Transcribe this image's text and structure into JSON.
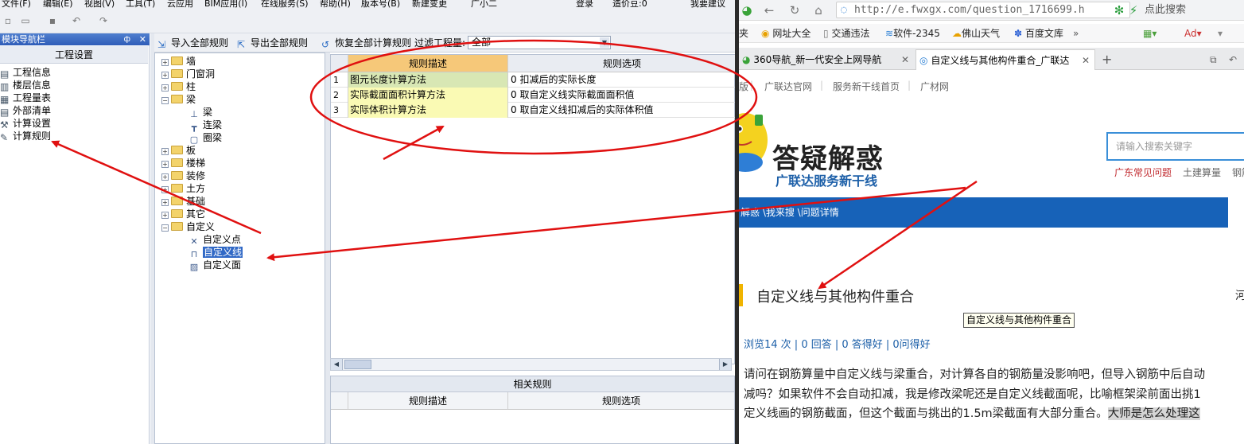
{
  "menubar": [
    "文件(F)",
    "编辑(E)",
    "视图(V)",
    "工具(T)",
    "云应用",
    "BIM应用(I)",
    "在线服务(S)",
    "帮助(H)",
    "版本号(B)",
    "新建变更",
    "广小二",
    "登录",
    "造价豆:0",
    "我要建议"
  ],
  "nav": {
    "title": "模块导航栏",
    "pin": "ф",
    "close": "✕",
    "group": "工程设置",
    "items": [
      "工程信息",
      "楼层信息",
      "工程量表",
      "外部清单",
      "计算设置",
      "计算规则"
    ]
  },
  "rulebar": {
    "import_all": "导入全部规则",
    "export_all": "导出全部规则",
    "restore_all": "恢复全部计算规则",
    "filter_label": "过滤工程量:",
    "filter_value": "全部"
  },
  "tree": {
    "folders": [
      "墙",
      "门窗洞",
      "柱",
      "梁",
      "板",
      "楼梯",
      "装修",
      "土方",
      "基础",
      "其它",
      "自定义"
    ],
    "beam_children": [
      "梁",
      "连梁",
      "圈梁"
    ],
    "custom_children": [
      "自定义点",
      "自定义线",
      "自定义面"
    ]
  },
  "grid": {
    "headers": [
      "规则描述",
      "规则选项"
    ],
    "rows": [
      {
        "n": "1",
        "desc": "图元长度计算方法",
        "opt": "0  扣减后的实际长度"
      },
      {
        "n": "2",
        "desc": "实际截面面积计算方法",
        "opt": "0   取自定义线实际截面面积值"
      },
      {
        "n": "3",
        "desc": "实际体积计算方法",
        "opt": "0   取自定义线扣减后的实际体积值"
      }
    ]
  },
  "related": {
    "title": "相关规则",
    "headers": [
      "规则描述",
      "规则选项"
    ]
  },
  "browser": {
    "url": "http://e.fwxgx.com/question_1716699.h",
    "search_placeholder": "点此搜索",
    "bookmarks": [
      "网址大全",
      "交通违法",
      "软件-2345",
      "佛山天气",
      "百度文库",
      "»"
    ],
    "bookmark_prefix": "夹",
    "tabs": [
      {
        "title": "360导航_新一代安全上网导航",
        "active": false
      },
      {
        "title": "自定义线与其他构件重合_广联达",
        "active": true
      }
    ],
    "new_tab": "+",
    "site_nav": [
      "版",
      "广联达官网",
      "服务新干线首页",
      "广材网"
    ],
    "logo_title": "答疑解惑",
    "logo_sub": "广联达服务新干线",
    "site_search_placeholder": "请输入搜索关键字",
    "categories": [
      "广东常见问题",
      "土建算量",
      "钢筋"
    ],
    "breadcrumb": "解惑 \\我来搜 \\问题详情",
    "question_title": "自定义线与其他构件重合",
    "question_more": "河",
    "tooltip": "自定义线与其他构件重合",
    "stats": "浏览14 次 | 0 回答 | 0 答得好 | 0问得好",
    "body_lines": [
      "请问在钢筋算量中自定义线与梁重合，对计算各自的钢筋量没影响吧，但导入钢筋中后自动",
      "减吗？如果软件不会自动扣减，我是修改梁呢还是自定义线截面呢，比喻框架梁前面出挑1",
      "定义线画的钢筋截面，但这个截面与挑出的1.5m梁截面有大部分重合。"
    ],
    "body_highlight": "大师是怎么处理这"
  },
  "colors": {
    "annotation": "#e01010",
    "selection": "#3169c6",
    "rule_desc_bg": "#fafab4",
    "header_highlight": "#f6c879",
    "site_blue": "#1762b8",
    "accent_yellow": "#f0b400"
  }
}
